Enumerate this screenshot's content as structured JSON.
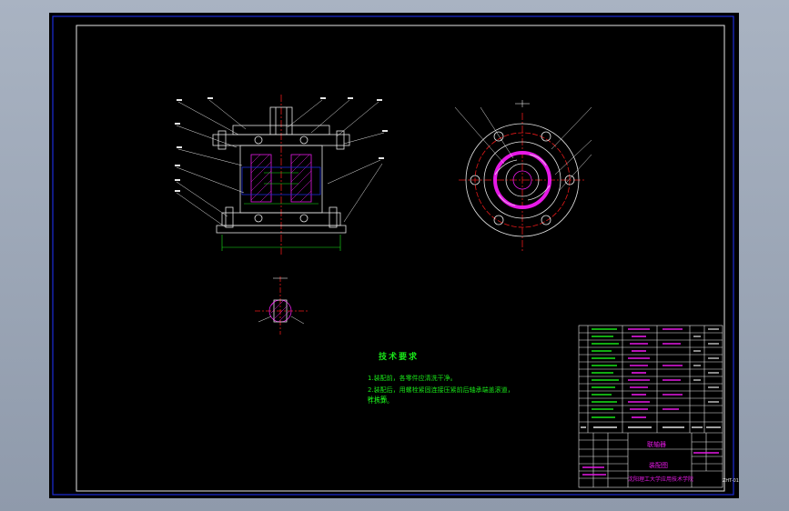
{
  "canvas": {
    "background": "#000000",
    "frame_color": "#1c2bd8",
    "screen_bg": "#9aa5b6"
  },
  "colors": {
    "outline": "#e6e6e6",
    "hatch": "#e619e6",
    "center": "#e61919",
    "dimension": "#19e619",
    "hidden": "#1c2bd8",
    "leader": "#e6e6e6"
  },
  "technical_requirements": {
    "title": "技术要求",
    "items": [
      "1.装配前，各零件应清洗干净。",
      "2.装配后，用螺栓紧固连接压紧前后轴承端盖滚道，叶片等",
      "件拆卸。"
    ]
  },
  "title_block": {
    "part_name": "联轴器",
    "drawing_title": "装配图",
    "school": "沈阳理工大学应用技术学院",
    "drawing_code": "ZHT-01"
  },
  "icons": [
    "section-arrow-icon",
    "leader-balloon-icon"
  ]
}
